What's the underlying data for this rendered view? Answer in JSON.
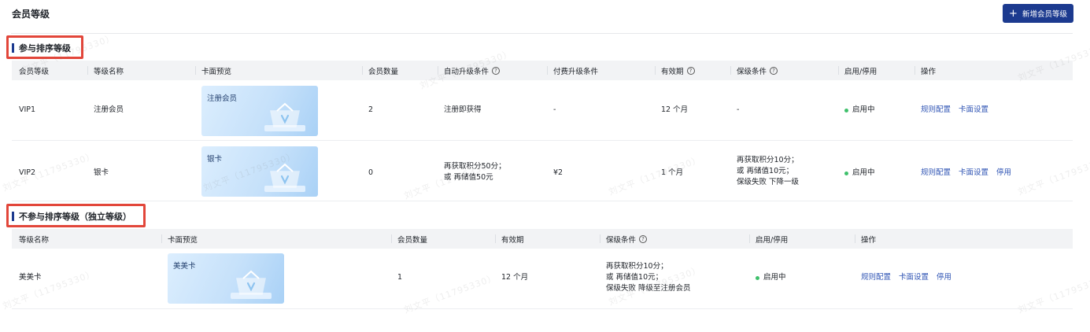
{
  "page": {
    "title": "会员等级",
    "add_button": "新增会员等级"
  },
  "sections": {
    "ranked": {
      "title": "参与排序等级"
    },
    "independent": {
      "title": "不参与排序等级（独立等级）"
    }
  },
  "ranked_table": {
    "headers": [
      "会员等级",
      "等级名称",
      "卡面预览",
      "会员数量",
      "自动升级条件",
      "付费升级条件",
      "有效期",
      "保级条件",
      "启用/停用",
      "操作"
    ],
    "rows": [
      {
        "level": "VIP1",
        "name": "注册会员",
        "card": "注册会员",
        "count": "2",
        "auto_upgrade": [
          "注册即获得"
        ],
        "paid_upgrade": "-",
        "validity": "12 个月",
        "retain": [
          "-"
        ],
        "status": "启用中",
        "ops": [
          "规则配置",
          "卡面设置"
        ]
      },
      {
        "level": "VIP2",
        "name": "银卡",
        "card": "银卡",
        "count": "0",
        "auto_upgrade": [
          "再获取积分50分；",
          "或 再储值50元"
        ],
        "paid_upgrade": "¥2",
        "validity": "1 个月",
        "retain": [
          "再获取积分10分；",
          "或 再储值10元；",
          "保级失败 下降一级"
        ],
        "status": "启用中",
        "ops": [
          "规则配置",
          "卡面设置",
          "停用"
        ]
      }
    ]
  },
  "independent_table": {
    "headers": [
      "等级名称",
      "卡面预览",
      "会员数量",
      "有效期",
      "保级条件",
      "启用/停用",
      "操作"
    ],
    "rows": [
      {
        "name": "美美卡",
        "card": "美美卡",
        "count": "1",
        "validity": "12 个月",
        "retain": [
          "再获取积分10分；",
          "或 再储值10元；",
          "保级失败 降级至注册会员"
        ],
        "status": "启用中",
        "ops": [
          "规则配置",
          "卡面设置",
          "停用"
        ]
      }
    ]
  },
  "watermark": "刘文平（11795330）",
  "colors": {
    "primary": "#1c3a8f",
    "link": "#2f54b4",
    "status_on": "#3ec06b",
    "highlight": "#e2463a"
  }
}
